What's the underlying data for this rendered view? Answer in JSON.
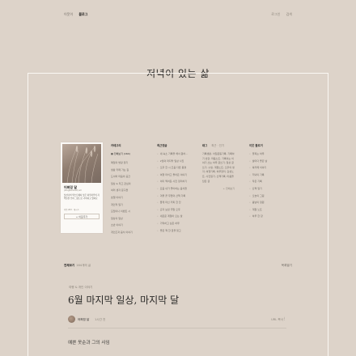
{
  "topnav": {
    "items": [
      "이웃이",
      "블로그"
    ],
    "right": [
      "로그인",
      "검색"
    ]
  },
  "site_title": "저녁이 있는 삶",
  "profile": {
    "name": "어쩌밍 달",
    "handle": "(blogbamnet) all",
    "bio": "낮선나의 텍스트에서 낮은 하루하루의 기억들을 쓰며 그림으로 기록하고 있어요",
    "meta": "이웃 203 · 게시 1",
    "subscribe": "+ 이웃추가"
  },
  "categories": {
    "title": "카테고리",
    "root": "전체보기 (164)",
    "items": [
      "매일의 방랑 읽기",
      "생활 카페 가는 길",
      "도서와 마음의 공간",
      "일상 & 작고 관심의",
      "여러 생각 문구들",
      "호텔 이야기",
      "개인적 일기",
      "모임이나 이벤트 시",
      "일상의 일상",
      "초반 이야기",
      "개인조과 음식 이야기"
    ]
  },
  "recent": {
    "title": "최근댓글",
    "items": [
      "새 숙소 기록을 해서 원하...",
      "2월의 마지막 일상 사진",
      "오후 한 시 즈음 다른 풍경",
      "여행 마치고 돌아온 이야기",
      "이미 찍어둔 사진 정리하기",
      "요즘 내가 좋아하는 음식들",
      "겨울 끝 무렵의 산책 기록",
      "짧게 마신 커피 한 잔",
      "혼자 보낸 주말 오후",
      "새로운 계절이 오는 날",
      "기억하고 싶은 하루",
      "좋은 책 한 권을 읽고"
    ]
  },
  "tags": {
    "title": "태그",
    "more": "최근 · 인기",
    "lines": [
      "기록생활, 아침운동기록, 기록하기 습관, 마음노트, 기록이는 이야기 쓰는 하루 글쓰기, 일상 글쓰기, 수필, 계절노트, 오후의 생각, 여행기록, 하루정리, 감성노트, 사진일기, 산책기록, 마음을 담은 글"
    ],
    "foot": "+ 전체보기"
  },
  "neighbors": {
    "title": "이웃 블로거",
    "items": [
      "꽃피는 하루",
      "날마다 좋은 날",
      "북카페 이야기",
      "저녁의 기록",
      "작은 기록",
      "산책 일기",
      "오늘의 그림",
      "봄날의 정원",
      "계절 노트",
      "하루 한 장"
    ]
  },
  "catbar": {
    "title": "전체보기",
    "count": "164개의 글",
    "right": "목록열기"
  },
  "post": {
    "category": "여행 & 개인 이야기",
    "title": "6월 마지막 일상, 마지막 달",
    "author": "어쩌밍 달",
    "time": "1시간 전",
    "actions": "URL 복사",
    "subheading": "예쁜 옷순과 그의 사임"
  }
}
